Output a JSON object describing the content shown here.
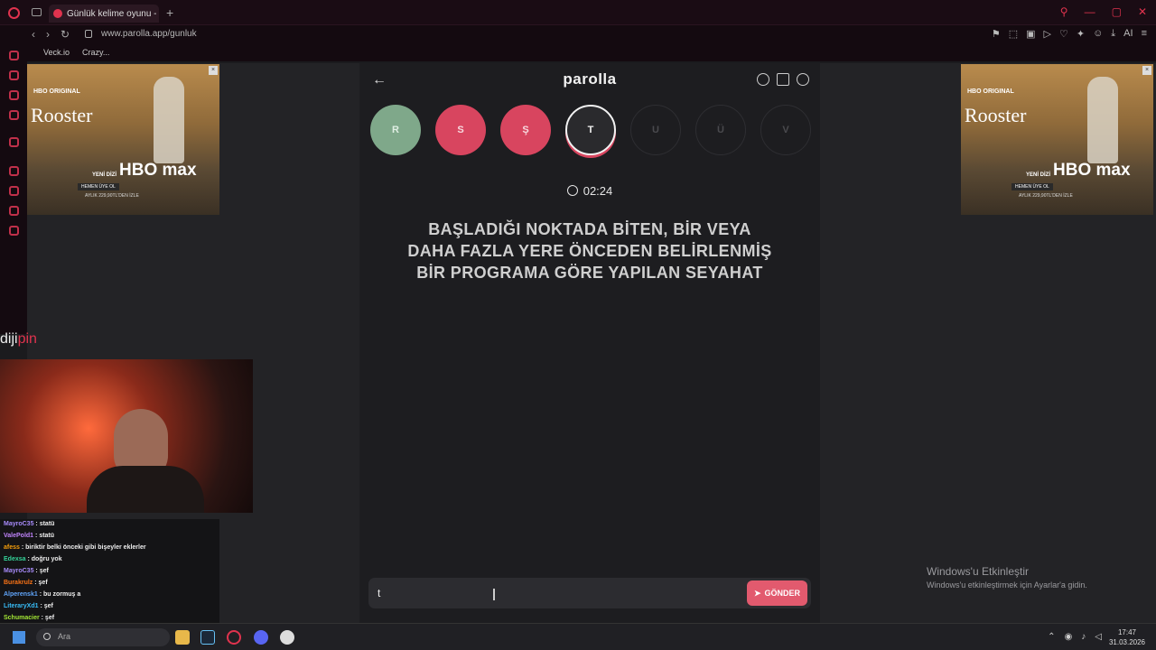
{
  "browser": {
    "tab_title": "Günlük kelime oyunu - par",
    "new_tab": "+",
    "url": "www.parolla.app/gunluk",
    "bookmarks": [
      "Veck.io",
      "Crazy..."
    ]
  },
  "app": {
    "logo": "parolla",
    "back_icon": "←",
    "letters": [
      {
        "label": "R",
        "state": "correct"
      },
      {
        "label": "S",
        "state": "wrong"
      },
      {
        "label": "Ş",
        "state": "wrong"
      },
      {
        "label": "T",
        "state": "current"
      },
      {
        "label": "U",
        "state": "pending"
      },
      {
        "label": "Ü",
        "state": "pending"
      },
      {
        "label": "V",
        "state": "pending"
      }
    ],
    "timer": "02:24",
    "question": "BAŞLADIĞI NOKTADA BİTEN, BİR VEYA DAHA FAZLA YERE ÖNCEDEN BELİRLENMİŞ BİR PROGRAMA GÖRE YAPILAN SEYAHAT",
    "input_value": "t",
    "send_label": "GÖNDER"
  },
  "ad": {
    "brand": "HBO ORIGINAL",
    "title": "Rooster",
    "badge": "YENİ DİZİ",
    "cta": "HEMEN ÜYE OL",
    "logo": "HBO max",
    "price": "AYLIK 229,90TL'DEN İZLE"
  },
  "overlay": {
    "brand_prefix": "diji",
    "brand_suffix": "pin"
  },
  "chat": [
    {
      "user": "MayroC35",
      "text": "statü",
      "color": "#a78bfa"
    },
    {
      "user": "ValePold1",
      "text": "statü",
      "color": "#c084fc"
    },
    {
      "user": "afess",
      "text": "biriktir belki önceki gibi bişeyler eklerler",
      "color": "#f59e0b"
    },
    {
      "user": "Edexsa",
      "text": "doğru yok",
      "color": "#34d399"
    },
    {
      "user": "MayroC35",
      "text": "şef",
      "color": "#a78bfa"
    },
    {
      "user": "Burakrulz",
      "text": "şef",
      "color": "#f97316"
    },
    {
      "user": "Alperensk1",
      "text": "bu zormuş a",
      "color": "#60a5fa"
    },
    {
      "user": "LiteraryXd1",
      "text": "şef",
      "color": "#38bdf8"
    },
    {
      "user": "Schumacier",
      "text": "şef",
      "color": "#a3e635"
    }
  ],
  "activation": {
    "line1": "Windows'u Etkinleştir",
    "line2": "Windows'u etkinleştirmek için Ayarlar'a gidin."
  },
  "taskbar": {
    "search_placeholder": "Ara",
    "time": "17:47",
    "date": "31.03.2026"
  }
}
